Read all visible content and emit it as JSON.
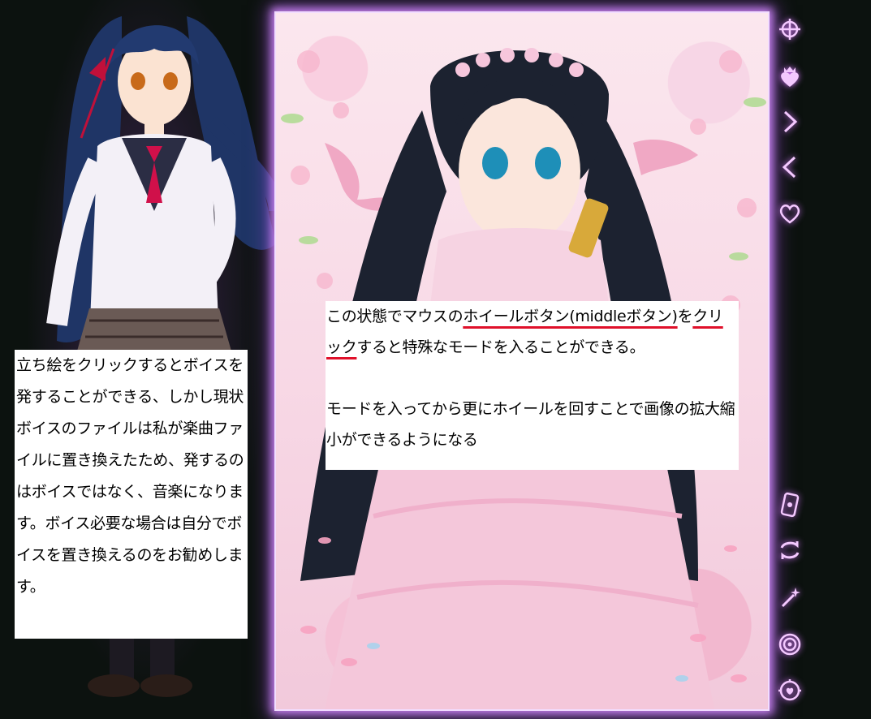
{
  "left_note": {
    "text": "立ち絵をクリックするとボイスを発することができる、しかし現状ボイスのファイルは私が楽曲ファイルに置き換えたため、発するのはボイスではなく、音楽になります。ボイス必要な場合は自分でボイスを置き換えるのをお勧めします。"
  },
  "center_note": {
    "line1_prefix": "この状態でマウスの",
    "line1_highlight": "ホイールボタン(middleボタン)",
    "line1_mid": "を",
    "line1_highlight2": "クリック",
    "line1_suffix": "すると特殊なモードを入ることができる。",
    "line2": "モードを入ってから更にホイールを回すことで画像の拡大縮小ができるようになる"
  },
  "menu": {
    "top": [
      {
        "name": "compass-icon"
      },
      {
        "name": "heart-crown-icon"
      },
      {
        "name": "next-arrow-icon"
      },
      {
        "name": "prev-arrow-icon"
      },
      {
        "name": "heart-outline-icon"
      }
    ],
    "bottom": [
      {
        "name": "card-icon"
      },
      {
        "name": "swap-icon"
      },
      {
        "name": "magic-wand-icon"
      },
      {
        "name": "spiral-icon"
      },
      {
        "name": "gear-heart-icon"
      }
    ]
  },
  "colors": {
    "accent_glow": "#d877ff",
    "underline": "#e0102a",
    "background": "#0c120f"
  }
}
